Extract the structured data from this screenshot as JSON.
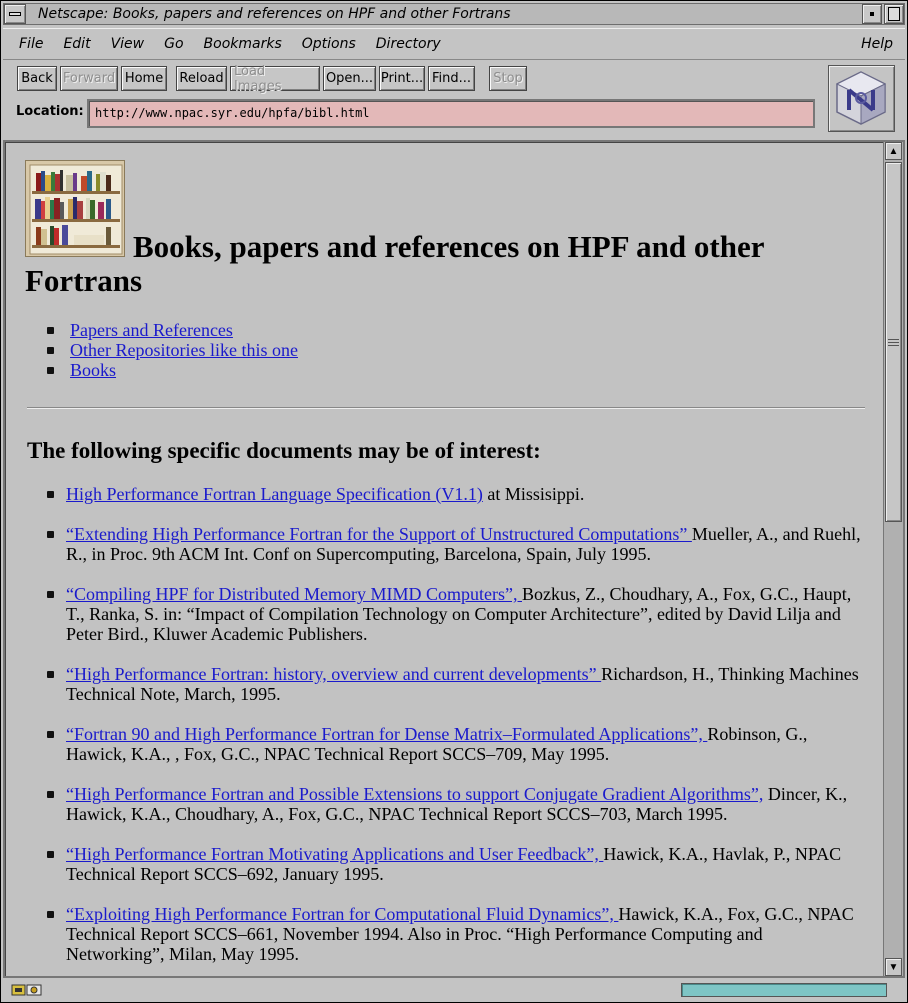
{
  "window": {
    "title": "Netscape: Books, papers and references on HPF and other Fortrans"
  },
  "menubar": {
    "items": [
      "File",
      "Edit",
      "View",
      "Go",
      "Bookmarks",
      "Options",
      "Directory"
    ],
    "help": "Help"
  },
  "toolbar": {
    "buttons": [
      {
        "label": "Back",
        "enabled": true
      },
      {
        "label": "Forward",
        "enabled": false
      },
      {
        "label": "Home",
        "enabled": true
      },
      {
        "label": "Reload",
        "enabled": true
      },
      {
        "label": "Load Images",
        "enabled": false
      },
      {
        "label": "Open...",
        "enabled": true
      },
      {
        "label": "Print...",
        "enabled": true
      },
      {
        "label": "Find...",
        "enabled": true
      },
      {
        "label": "Stop",
        "enabled": false
      }
    ]
  },
  "location": {
    "label": "Location:",
    "url": "http://www.npac.syr.edu/hpfa/bibl.html"
  },
  "page": {
    "title": "Books, papers and references on HPF and other Fortrans",
    "toc": [
      "Papers and References",
      "Other Repositories like this one",
      "Books"
    ],
    "section_title": "The following specific documents may be of interest:",
    "documents": [
      {
        "link": " High Performance Fortran Language Specification (V1.1)",
        "text": " at Missisippi."
      },
      {
        "link": " “Extending High Performance Fortran for the Support of Unstructured Computations” ",
        "text": "Mueller, A., and Ruehl, R., in Proc. 9th ACM Int. Conf on Supercomputing, Barcelona, Spain, July 1995."
      },
      {
        "link": " “Compiling HPF for Distributed Memory MIMD Computers”, ",
        "text": "Bozkus, Z., Choudhary, A., Fox, G.C., Haupt, T., Ranka, S. in: “Impact of Compilation Technology on Computer Architecture”, edited by David Lilja and Peter Bird., Kluwer Academic Publishers."
      },
      {
        "link": " “High Performance Fortran: history, overview and current developments” ",
        "text": "Richardson, H., Thinking Machines Technical Note, March, 1995."
      },
      {
        "link": " “Fortran 90 and High Performance Fortran for Dense Matrix–Formulated Applications”, ",
        "text": "Robinson, G., Hawick, K.A., , Fox, G.C., NPAC Technical Report SCCS–709, May 1995."
      },
      {
        "link": " “High Performance Fortran and Possible Extensions to support Conjugate Gradient Algorithms”,",
        "text": " Dincer, K., Hawick, K.A., Choudhary, A., Fox, G.C., NPAC Technical Report SCCS–703, March 1995."
      },
      {
        "link": " “High Performance Fortran Motivating Applications and User Feedback”, ",
        "text": "Hawick, K.A., Havlak, P., NPAC Technical Report SCCS–692, January 1995."
      },
      {
        "link": " “Exploiting High Performance Fortran for Computational Fluid Dynamics”, ",
        "text": "Hawick, K.A., Fox, G.C., NPAC Technical Report SCCS–661, November 1994. Also in Proc. “High Performance Computing and Networking”, Milan, May 1995."
      }
    ]
  },
  "colors": {
    "link": "#1a1acc",
    "location_bg": "#e3b8b8",
    "progress": "#7ec5c5",
    "chrome": "#c4c4c4"
  },
  "icons": {
    "window_menu": "window-menu-icon",
    "netscape_logo": "netscape-cube-logo",
    "security": "key-icon",
    "mail": "mail-icon"
  }
}
